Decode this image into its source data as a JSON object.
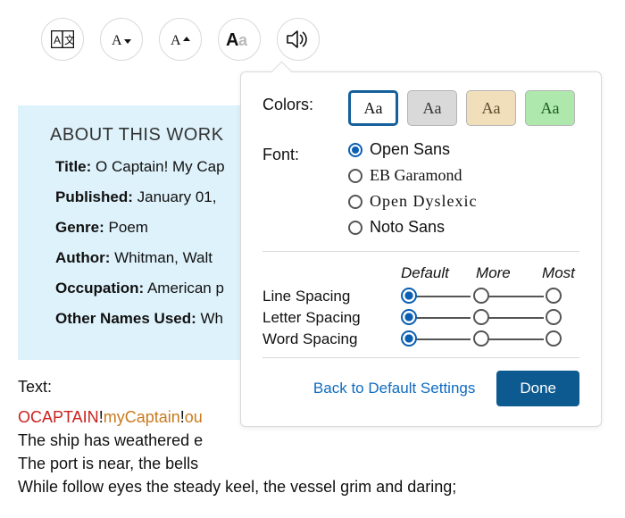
{
  "toolbar": {
    "translate_icon": "translate-icon",
    "decrease_icon": "font-decrease-icon",
    "increase_icon": "font-increase-icon",
    "style_icon": "font-style-icon",
    "audio_icon": "speaker-icon"
  },
  "infobox": {
    "heading": "ABOUT THIS WORK",
    "rows": [
      {
        "k": "Title:",
        "v": "O Captain! My Cap"
      },
      {
        "k": "Published:",
        "v": "January 01,"
      },
      {
        "k": "Genre:",
        "v": "Poem"
      },
      {
        "k": "Author:",
        "v": "Whitman, Walt"
      },
      {
        "k": "Occupation:",
        "v": "American p"
      },
      {
        "k": "Other Names Used:",
        "v": "Wh"
      }
    ]
  },
  "body": {
    "label": "Text:",
    "line1_a": "OCAPTAIN",
    "line1_b": "!",
    "line1_c": "myCaptain",
    "line1_d": "!",
    "line1_e": "ou",
    "line2": "The ship has weathered e",
    "line3": "The port is near, the bells",
    "line4": "While follow eyes the steady keel, the vessel grim and daring;"
  },
  "popover": {
    "colors_label": "Colors:",
    "swatch_text": "Aa",
    "swatches": [
      {
        "bg": "#ffffff",
        "fg": "#111111",
        "selected": true
      },
      {
        "bg": "#d9d9d9",
        "fg": "#333333",
        "selected": false
      },
      {
        "bg": "#f1deba",
        "fg": "#5a4a2a",
        "selected": false
      },
      {
        "bg": "#aee8ad",
        "fg": "#1d5a1d",
        "selected": false
      }
    ],
    "font_label": "Font:",
    "fonts": [
      {
        "name": "Open Sans",
        "css": "font-opensans",
        "selected": true
      },
      {
        "name": "EB Garamond",
        "css": "font-garamond",
        "selected": false
      },
      {
        "name": "Open Dyslexic",
        "css": "font-dyslexic",
        "selected": false
      },
      {
        "name": "Noto Sans",
        "css": "font-noto",
        "selected": false
      }
    ],
    "spacing_headers": [
      "Default",
      "More",
      "Most"
    ],
    "spacings": [
      {
        "name": "Line Spacing",
        "value": 0
      },
      {
        "name": "Letter Spacing",
        "value": 0
      },
      {
        "name": "Word Spacing",
        "value": 0
      }
    ],
    "reset_label": "Back to Default Settings",
    "done_label": "Done"
  }
}
